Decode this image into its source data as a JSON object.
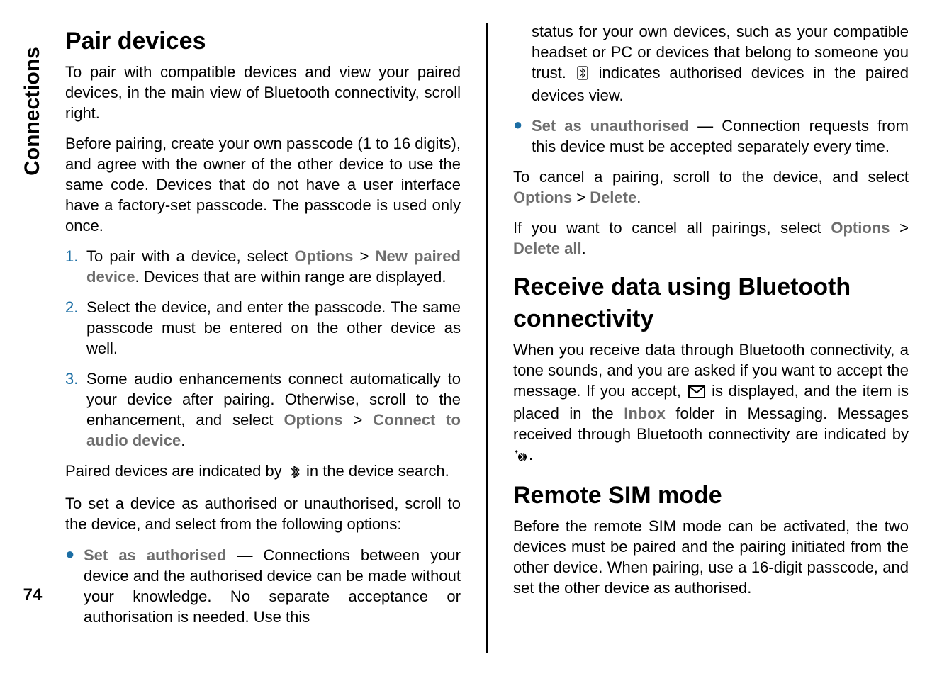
{
  "sidebar": {
    "section_label": "Connections",
    "page_number": "74"
  },
  "left": {
    "heading_pair": "Pair devices",
    "p_intro": "To pair with compatible devices and view your paired devices, in the main view of Bluetooth connectivity, scroll right.",
    "p_passcode": "Before pairing, create your own passcode (1 to 16 digits), and agree with the owner of the other device to use the same code. Devices that do not have a user interface have a factory-set passcode. The passcode is used only once.",
    "steps": [
      {
        "num": "1.",
        "pre": "To pair with a device, select ",
        "opts1": "Options",
        "sep1": " > ",
        "opts2": "New paired device",
        "post": ". Devices that are within range are displayed."
      },
      {
        "num": "2.",
        "text": "Select the device, and enter the passcode. The same passcode must be entered on the other device as well."
      },
      {
        "num": "3.",
        "pre": "Some audio enhancements connect automatically to your device after pairing. Otherwise, scroll to the enhancement, and select ",
        "opts1": "Options",
        "sep1": " > ",
        "opts2": "Connect to audio device",
        "post": "."
      }
    ],
    "p_paired_pre": "Paired devices are indicated by ",
    "p_paired_post": " in the device search.",
    "p_authset": "To set a device as authorised or unauthorised, scroll to the device, and select from the following options:",
    "bullet_auth": {
      "label": "Set as authorised",
      "text": " — Connections between your device and the authorised device can be made without your knowledge. No separate acceptance or authorisation is needed. Use this"
    }
  },
  "right": {
    "cont_pre": "status for your own devices, such as your compatible headset or PC or devices that belong to someone you trust. ",
    "cont_post": " indicates authorised devices in the paired devices view.",
    "bullet_unauth": {
      "label": "Set as unauthorised",
      "text": " — Connection requests from this device must be accepted separately every time."
    },
    "p_cancel_pre": "To cancel a pairing, scroll to the device, and select ",
    "p_cancel_o1": "Options",
    "p_cancel_sep": " > ",
    "p_cancel_o2": "Delete",
    "p_cancel_post": ".",
    "p_cancel_all_pre": "If you want to cancel all pairings, select ",
    "p_cancel_all_o1": "Options",
    "p_cancel_all_sep": " > ",
    "p_cancel_all_o2": "Delete all",
    "p_cancel_all_post": ".",
    "heading_receive": "Receive data using Bluetooth connectivity",
    "p_receive_pre": "When you receive data through Bluetooth connectivity, a tone sounds, and you are asked if you want to accept the message. If you accept, ",
    "p_receive_mid1": " is displayed, and the item is placed in the ",
    "p_receive_inbox": "Inbox",
    "p_receive_mid2": " folder in Messaging. Messages received through Bluetooth connectivity are indicated by ",
    "p_receive_post": ".",
    "heading_remote": "Remote SIM mode",
    "p_remote": "Before the remote SIM mode can be activated, the two devices must be paired and the pairing initiated from the other device. When pairing, use a 16-digit passcode, and set the other device as authorised."
  }
}
